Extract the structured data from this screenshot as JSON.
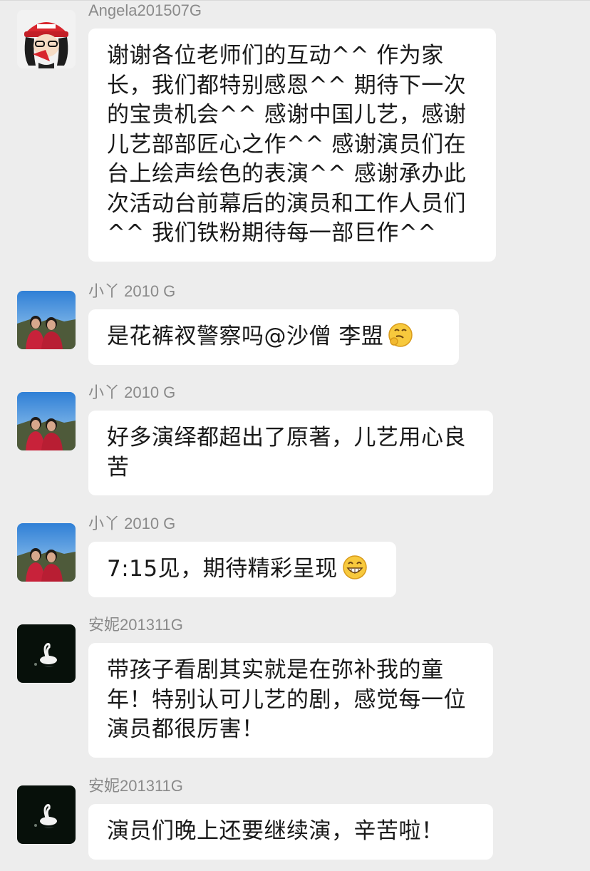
{
  "chat": {
    "messages": [
      {
        "sender": "Angela201507G",
        "avatar": "cartoon-girl-red-hat-avatar",
        "text": "谢谢各位老师们的互动^^ 作为家长，我们都特别感恩^^ 期待下一次的宝贵机会^^ 感谢中国儿艺，感谢儿艺部部匠心之作^^ 感谢演员们在台上绘声绘色的表演^^ 感谢承办此次活动台前幕后的演员和工作人员们^^ 我们铁粉期待每一部巨作^^"
      },
      {
        "sender": "小丫 2010 G",
        "avatar": "two-people-landscape-avatar",
        "text": "是花裤衩警察吗@沙僧 李盟",
        "emoji": "hmm-thinking-emoji"
      },
      {
        "sender": "小丫 2010 G",
        "avatar": "two-people-landscape-avatar",
        "text": "好多演绎都超出了原著，儿艺用心良苦"
      },
      {
        "sender": "小丫 2010 G",
        "avatar": "two-people-landscape-avatar",
        "text": "7:15见，期待精彩呈现",
        "emoji": "grin-emoji"
      },
      {
        "sender": "安妮201311G",
        "avatar": "white-swan-avatar",
        "text": "带孩子看剧其实就是在弥补我的童年！特别认可儿艺的剧，感觉每一位演员都很厉害！"
      },
      {
        "sender": "安妮201311G",
        "avatar": "white-swan-avatar",
        "text": "演员们晚上还要继续演，辛苦啦！"
      }
    ]
  },
  "colors": {
    "background": "#ededed",
    "bubble": "#ffffff",
    "sender_name": "#8a8a8a",
    "message_text": "#191919"
  }
}
